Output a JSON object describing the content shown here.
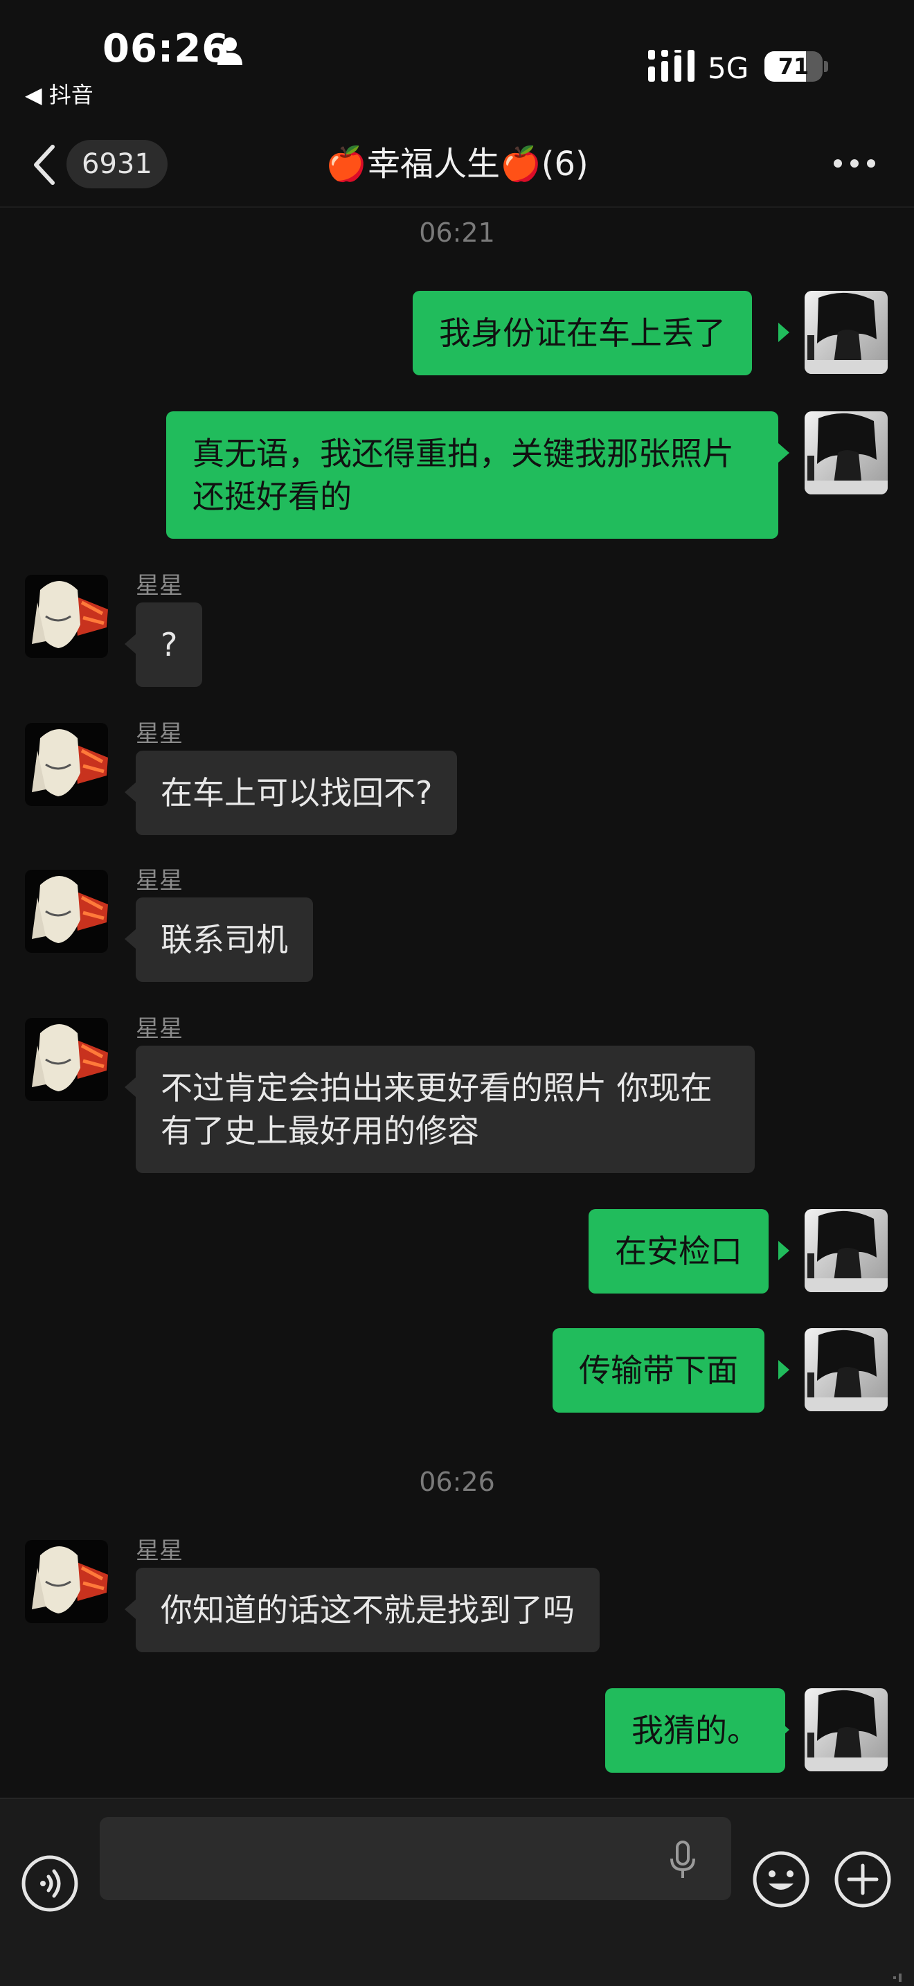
{
  "status_bar": {
    "time": "06:26",
    "back_app": "◀ 抖音",
    "network": "5G",
    "battery": "71",
    "battery_level": 0.71
  },
  "header": {
    "unread_count": "6931",
    "title": "🍎幸福人生🍎(6)"
  },
  "timestamps": [
    "06:21",
    "06:26"
  ],
  "messages": [
    {
      "direction": "out",
      "text": "我身份证在车上丢了"
    },
    {
      "direction": "out",
      "text": "真无语，我还得重拍，关键我那张照片还挺好看的"
    },
    {
      "direction": "in",
      "sender": "星星",
      "text": "?"
    },
    {
      "direction": "in",
      "sender": "星星",
      "text": "在车上可以找回不?"
    },
    {
      "direction": "in",
      "sender": "星星",
      "text": "联系司机"
    },
    {
      "direction": "in",
      "sender": "星星",
      "text": "不过肯定会拍出来更好看的照片 你现在有了史上最好用的修容"
    },
    {
      "direction": "out",
      "text": "在安检口"
    },
    {
      "direction": "out",
      "text": "传输带下面"
    },
    {
      "direction": "in",
      "sender": "星星",
      "text": "你知道的话这不就是找到了吗"
    },
    {
      "direction": "out",
      "text": "我猜的。"
    }
  ],
  "input": {
    "value": "",
    "placeholder": ""
  },
  "icons": {
    "back": "chevron-left-icon",
    "more": "more-dots-icon",
    "voice": "voice-icon",
    "mic": "mic-icon",
    "emoji": "emoji-icon",
    "plus": "plus-icon"
  },
  "colors": {
    "background": "#111111",
    "outgoing_bubble": "#21bc5c",
    "incoming_bubble": "#2c2c2c"
  }
}
